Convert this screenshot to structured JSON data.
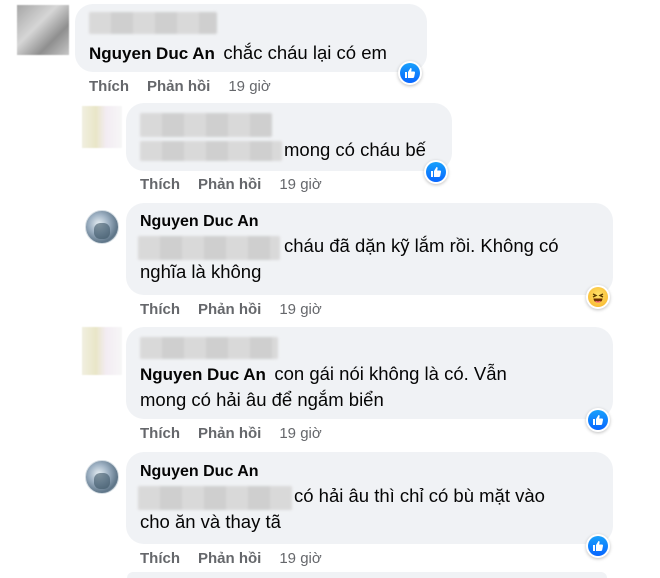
{
  "comments": [
    {
      "author": "Nguyen Duc An",
      "text": "chắc cháu lại có em",
      "actions": {
        "like": "Thích",
        "reply": "Phản hồi",
        "time": "19 giờ"
      },
      "reaction": "like-icon"
    },
    {
      "author": "",
      "text": "mong có cháu bế",
      "actions": {
        "like": "Thích",
        "reply": "Phản hồi",
        "time": "19 giờ"
      },
      "reaction": "like-icon"
    },
    {
      "author": "Nguyen Duc An",
      "text_line1": "cháu đã dặn kỹ lắm rồi. Không có",
      "text_line2": "nghĩa là không",
      "actions": {
        "like": "Thích",
        "reply": "Phản hồi",
        "time": "19 giờ"
      },
      "reaction": "haha-icon"
    },
    {
      "author": "Nguyen Duc An",
      "text_line1": "con gái nói không là có. Vẫn",
      "text_line2": "mong có hải âu để ngắm biển",
      "actions": {
        "like": "Thích",
        "reply": "Phản hồi",
        "time": "19 giờ"
      },
      "reaction": "like-icon"
    },
    {
      "author": "Nguyen Duc An",
      "text_line1": "có hải âu thì chỉ có bù mặt vào",
      "text_line2": "cho ăn và thay tã",
      "actions": {
        "like": "Thích",
        "reply": "Phản hồi",
        "time": "19 giờ"
      },
      "reaction": "like-icon"
    }
  ],
  "colors": {
    "bubble": "#f0f2f5",
    "meta": "#65676b",
    "like": "#0866ff",
    "haha": "#f7b125"
  }
}
